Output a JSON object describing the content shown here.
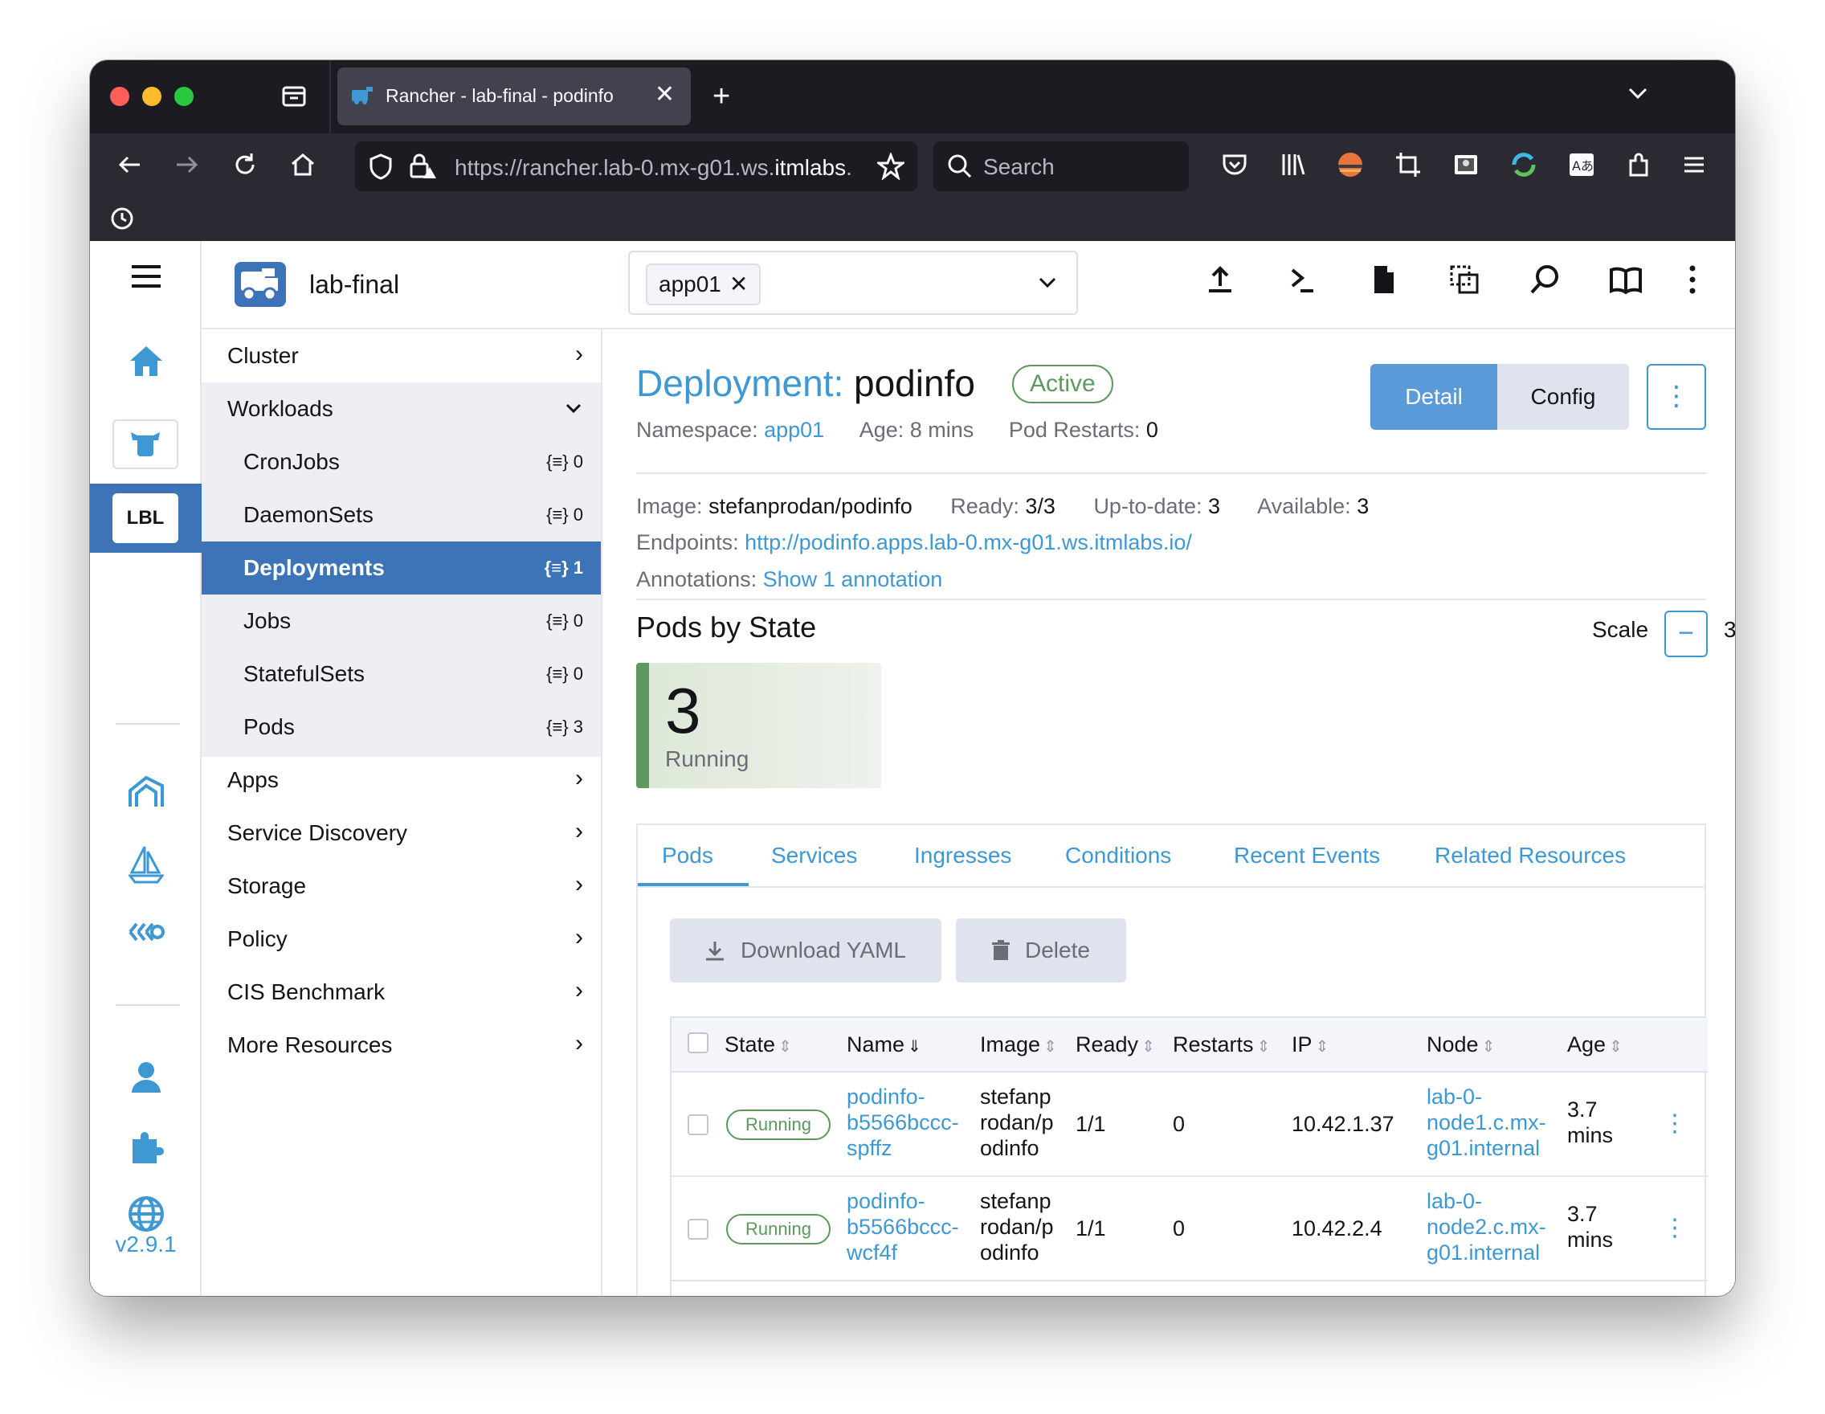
{
  "browser": {
    "tab_title": "Rancher - lab-final - podinfo",
    "url_prefix": "https://rancher.lab-0.mx-g01.ws.",
    "url_domain": "itmlabs",
    "url_suffix": ".",
    "search_placeholder": "Search"
  },
  "rail": {
    "lbl_label": "LBL",
    "version": "v2.9.1"
  },
  "header": {
    "cluster_name": "lab-final",
    "namespace_chip": "app01"
  },
  "sidenav": {
    "cluster": "Cluster",
    "workloads": "Workloads",
    "children": [
      {
        "label": "CronJobs",
        "count": "0"
      },
      {
        "label": "DaemonSets",
        "count": "0"
      },
      {
        "label": "Deployments",
        "count": "1"
      },
      {
        "label": "Jobs",
        "count": "0"
      },
      {
        "label": "StatefulSets",
        "count": "0"
      },
      {
        "label": "Pods",
        "count": "3"
      }
    ],
    "groups": [
      "Apps",
      "Service Discovery",
      "Storage",
      "Policy",
      "CIS Benchmark",
      "More Resources"
    ]
  },
  "deployment": {
    "kind_label": "Deployment:",
    "name": "podinfo",
    "status": "Active",
    "namespace_label": "Namespace:",
    "namespace": "app01",
    "age_label": "Age:",
    "age": "8 mins",
    "restarts_label": "Pod Restarts:",
    "restarts": "0",
    "detail_btn": "Detail",
    "config_btn": "Config",
    "image_label": "Image:",
    "image": "stefanprodan/podinfo",
    "ready_label": "Ready:",
    "ready": "3/3",
    "uptodate_label": "Up-to-date:",
    "uptodate": "3",
    "available_label": "Available:",
    "available": "3",
    "endpoints_label": "Endpoints:",
    "endpoint": "http://podinfo.apps.lab-0.mx-g01.ws.itmlabs.io/",
    "annotations_label": "Annotations:",
    "annotations_link": "Show 1 annotation"
  },
  "pods_by_state": {
    "title": "Pods by State",
    "scale_label": "Scale",
    "scale_value": "3",
    "running_count": "3",
    "running_label": "Running"
  },
  "tabs": [
    "Pods",
    "Services",
    "Ingresses",
    "Conditions",
    "Recent Events",
    "Related Resources"
  ],
  "actions": {
    "download": "Download YAML",
    "delete": "Delete"
  },
  "table": {
    "columns": [
      "State",
      "Name",
      "Image",
      "Ready",
      "Restarts",
      "IP",
      "Node",
      "Age"
    ],
    "rows": [
      {
        "state": "Running",
        "name_lines": [
          "podinfo-",
          "b5566bccc-",
          "spffz"
        ],
        "image_lines": [
          "stefanp",
          "rodan/p",
          "odinfo"
        ],
        "ready": "1/1",
        "restarts": "0",
        "ip": "10.42.1.37",
        "node_lines": [
          "lab-0-",
          "node1.c.mx-",
          "g01.internal"
        ],
        "age_lines": [
          "3.7",
          "mins"
        ]
      },
      {
        "state": "Running",
        "name_lines": [
          "podinfo-",
          "b5566bccc-",
          "wcf4f"
        ],
        "image_lines": [
          "stefanp",
          "rodan/p",
          "odinfo"
        ],
        "ready": "1/1",
        "restarts": "0",
        "ip": "10.42.2.4",
        "node_lines": [
          "lab-0-",
          "node2.c.mx-",
          "g01.internal"
        ],
        "age_lines": [
          "3.7",
          "mins"
        ]
      }
    ]
  },
  "colors": {
    "accent": "#3d98d3",
    "active_nav": "#3d74b7",
    "running_green": "#5d995d",
    "browser_dark": "#1c1b22"
  }
}
